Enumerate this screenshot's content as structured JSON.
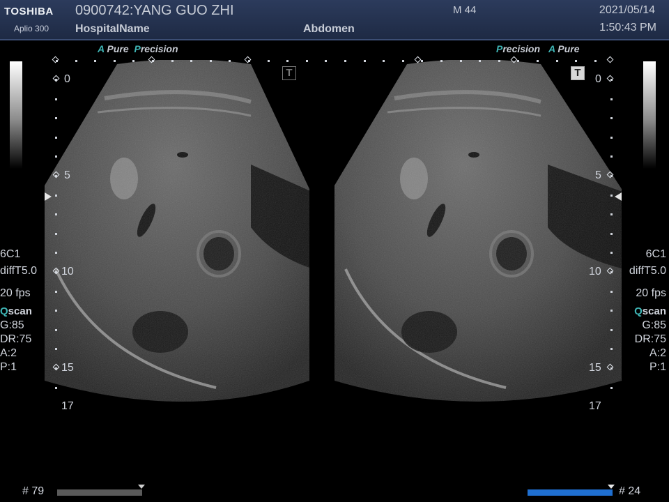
{
  "header": {
    "brand": "TOSHIBA",
    "model": "Aplio 300",
    "patient": "0900742:YANG GUO ZHI",
    "hospital": "HospitalName",
    "mode": "M 44",
    "preset": "Abdomen",
    "date": "2021/05/14",
    "time": "1:50:43 PM"
  },
  "left_panel": {
    "brand_a": "A",
    "brand_pure": "Pure",
    "brand_p": "P",
    "brand_precision": "recision",
    "transducer": "6C1",
    "freq": "diffT5.0",
    "fps": "20 fps",
    "qscan_q": "Q",
    "qscan_rest": "scan",
    "gain": "G:85",
    "dr": "DR:75",
    "a": "A:2",
    "p": "P:1",
    "depth_labels": [
      "0",
      "5",
      "10",
      "15",
      "17"
    ],
    "frame": "# 79",
    "cine_position": 1.0,
    "t_icon": "T"
  },
  "right_panel": {
    "brand_p": "P",
    "brand_precision": "recision",
    "brand_a": "A",
    "brand_pure": "Pure",
    "transducer": "6C1",
    "freq": "diffT5.0",
    "fps": "20 fps",
    "qscan_q": "Q",
    "qscan_rest": "scan",
    "gain": "G:85",
    "dr": "DR:75",
    "a": "A:2",
    "p": "P:1",
    "depth_labels": [
      "0",
      "5",
      "10",
      "15",
      "17"
    ],
    "frame": "# 24",
    "cine_position": 1.0,
    "t_icon": "T"
  },
  "colors": {
    "header_bg": "#24324f",
    "accent_teal": "#3fb6b6",
    "cine_left": "#5a5a5a",
    "cine_right": "#1f6fd0"
  },
  "icons": [
    "gray-scale-bar",
    "t-icon",
    "focus-marker-arrow",
    "cine-bar"
  ]
}
